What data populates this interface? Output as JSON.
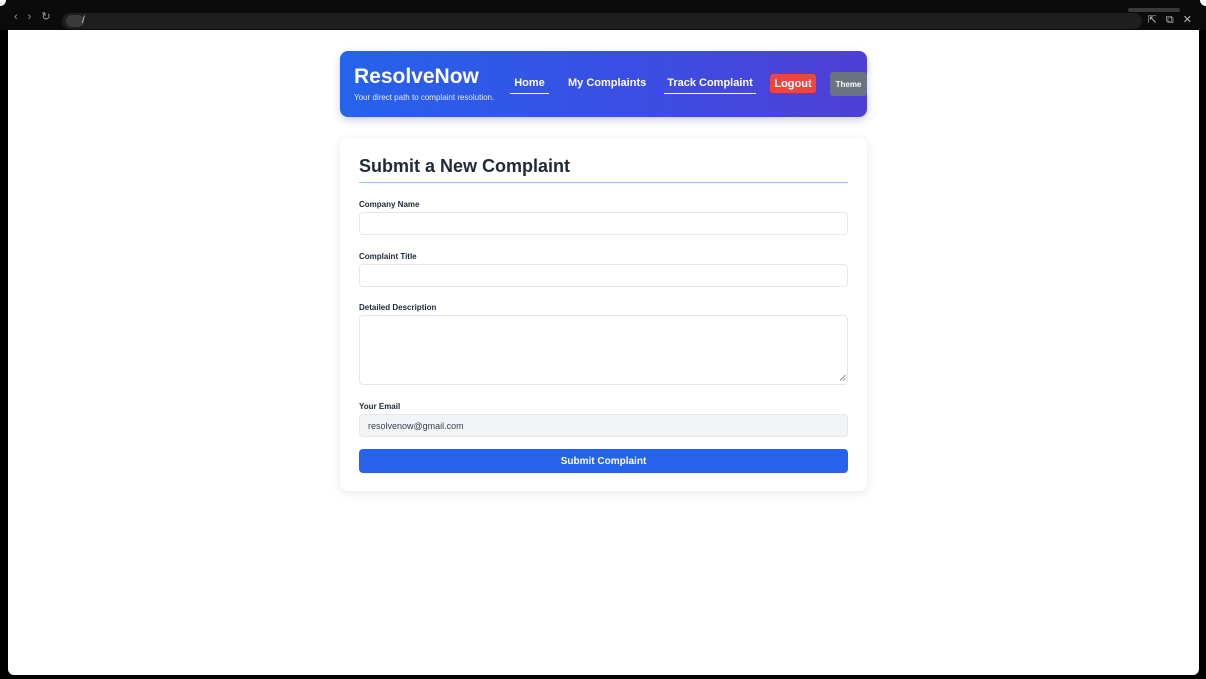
{
  "browser": {
    "url": "/",
    "icons": {
      "back": "‹",
      "forward": "›",
      "reload": "↻",
      "pointer": "⇱",
      "window": "⧉",
      "close": "✕"
    }
  },
  "header": {
    "brand": "ResolveNow",
    "tagline": "Your direct path to complaint resolution.",
    "nav": {
      "home": "Home",
      "my_complaints": "My Complaints",
      "track": "Track Complaint"
    },
    "logout": "Logout",
    "theme": "Theme"
  },
  "form": {
    "title": "Submit a New Complaint",
    "company_label": "Company Name",
    "company_value": "",
    "title_label": "Complaint Title",
    "title_value": "",
    "description_label": "Detailed Description",
    "description_value": "",
    "email_label": "Your Email",
    "email_value": "resolvenow@gmail.com",
    "submit": "Submit Complaint"
  },
  "colors": {
    "header_gradient_start": "#2563eb",
    "header_gradient_end": "#4f3fd6",
    "logout": "#ef4444",
    "theme": "#6b7280",
    "submit": "#2563eb",
    "title_underline": "#93c5fd"
  }
}
